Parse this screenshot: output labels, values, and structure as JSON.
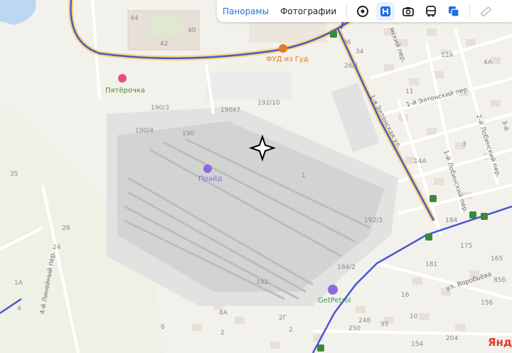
{
  "toolbar": {
    "tabs": [
      {
        "label": "Панорамы",
        "active": true
      },
      {
        "label": "Фотографии",
        "active": false
      }
    ],
    "tools": [
      "compass-icon",
      "route-icon",
      "camera-icon",
      "transit-icon",
      "layers-icon",
      "ruler-icon"
    ]
  },
  "pois": {
    "pyaterochka": "Пятёрочка",
    "food": "ФУД из Гуд",
    "praid": "Прайд",
    "getpetrol": "GetPetrol"
  },
  "streets": {
    "elton_1": "1-я Элтонская ул.",
    "elton_1_per": "1-й Элтонский пер.",
    "lobinsky_1": "1-й Лобинский пер.",
    "lobinsky_2": "2-й Лобинский пер.",
    "lineyny_4": "4-й Линейный пер.",
    "vorobeva": "ул. Воробьёва",
    "upper_per": "мский пер.",
    "far_right": "3-й"
  },
  "house_numbers": {
    "n44": "44",
    "n40": "40",
    "n42": "42",
    "n36": "36",
    "n34": "34",
    "n26_1": "26/1",
    "n190_3": "190/3",
    "n190x7": "190x7",
    "n192_10": "192/10",
    "n190_4": "190/4",
    "n190": "190",
    "n35": "35",
    "n28": "28",
    "n24": "24",
    "n1a": "1А",
    "n4": "4",
    "n192_3": "192/3",
    "n184_2": "184/2",
    "n192": "192",
    "n184": "184",
    "n175": "175",
    "n181": "181",
    "n165": "165",
    "n85b": "85Б",
    "n156": "156",
    "n12a": "12А",
    "n4a": "4А",
    "n11": "11",
    "n3": "3",
    "n14a": "14А",
    "n1": "1",
    "n248": "248",
    "n250": "250",
    "n8a": "8А",
    "n2g": "2Г",
    "n2": "2",
    "n204": "204",
    "n154": "154",
    "n16": "16",
    "n10": "10",
    "n6": "6",
    "n2b": "2",
    "n95": "95"
  },
  "colors": {
    "road_blue": "#4a56d6",
    "road_yellow": "#f6d87a",
    "accent": "#1f6fe0",
    "poi_purple": "#8e6ad8",
    "poi_orange": "#e07b2b",
    "brand": "#e03b2d"
  },
  "brand_text": "Янд"
}
